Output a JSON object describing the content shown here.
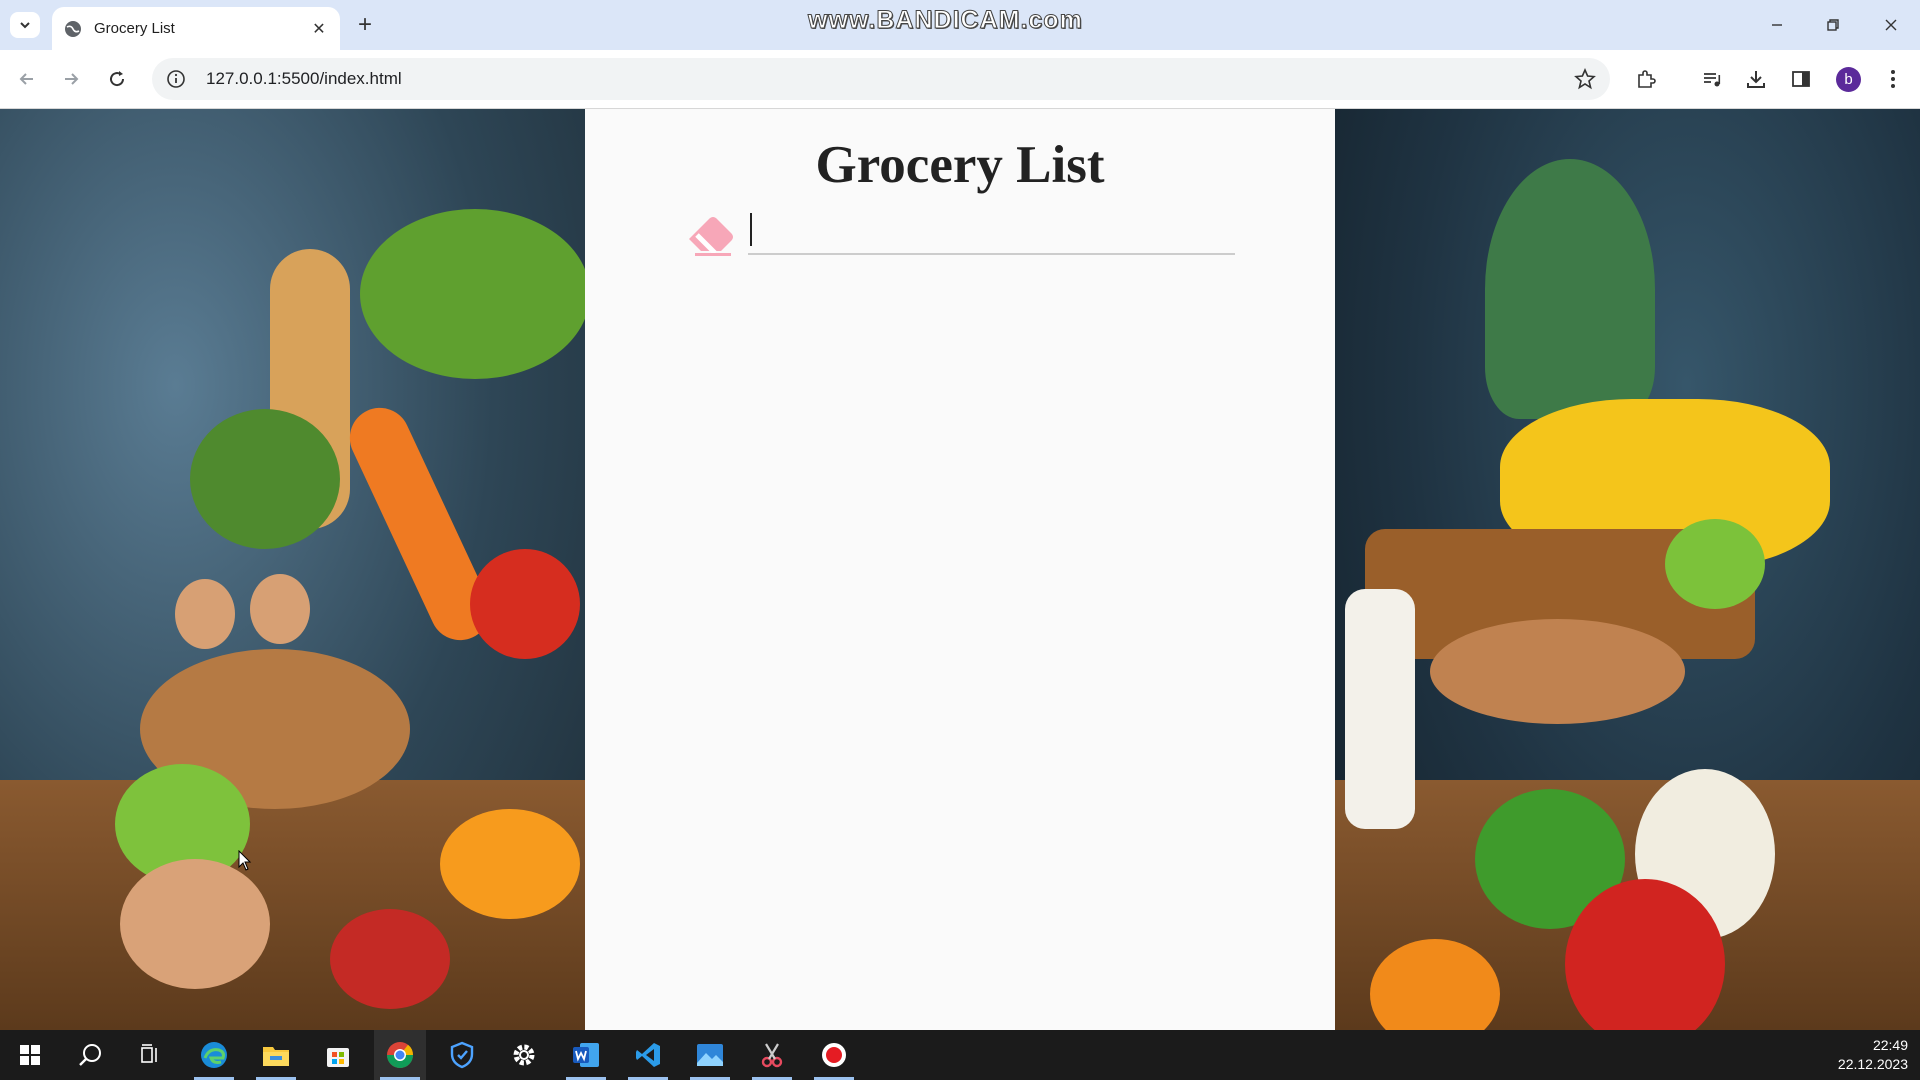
{
  "browser": {
    "tab_title": "Grocery List",
    "url": "127.0.0.1:5500/index.html",
    "profile_initial": "b",
    "watermark": "www.BANDICAM.com"
  },
  "page": {
    "title": "Grocery List",
    "input": {
      "value": "",
      "placeholder": ""
    },
    "eraser_icon_color": "#f7a7b8"
  },
  "taskbar": {
    "apps": [
      "start",
      "search",
      "task-view",
      "edge",
      "file-explorer",
      "store",
      "chrome",
      "defender",
      "settings",
      "word",
      "vscode",
      "photos",
      "snip",
      "bandicam"
    ],
    "time": "22:49",
    "date": "22.12.2023"
  },
  "colors": {
    "tab_strip": "#dbe6f8",
    "page_bg": "#fafafa",
    "taskbar": "#1b1b1b",
    "avatar": "#5b2a9a"
  }
}
